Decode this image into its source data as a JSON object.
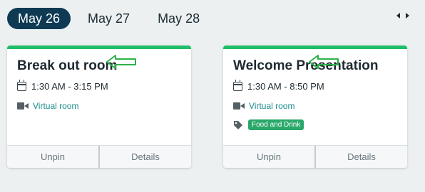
{
  "date_tabs": [
    {
      "label": "May 26",
      "active": true
    },
    {
      "label": "May 27",
      "active": false
    },
    {
      "label": "May 28",
      "active": false
    }
  ],
  "date_nav": {
    "prev_icon": "chevron-left-icon",
    "next_icon": "chevron-right-icon"
  },
  "cards": [
    {
      "title": "Break out room",
      "time": "1:30 AM - 3:15 PM",
      "room": "Virtual room",
      "tag": null,
      "unpin_label": "Unpin",
      "details_label": "Details"
    },
    {
      "title": "Welcome Presentation",
      "time": "1:30 AM - 8:50 PM",
      "room": "Virtual room",
      "tag": "Food and Drink",
      "unpin_label": "Unpin",
      "details_label": "Details"
    }
  ],
  "colors": {
    "accent": "#1fbf6a",
    "active_tab": "#0f3a54",
    "link": "#1a8a8a",
    "tag": "#2aa86a",
    "annotation_arrow": "#2bb24a"
  }
}
